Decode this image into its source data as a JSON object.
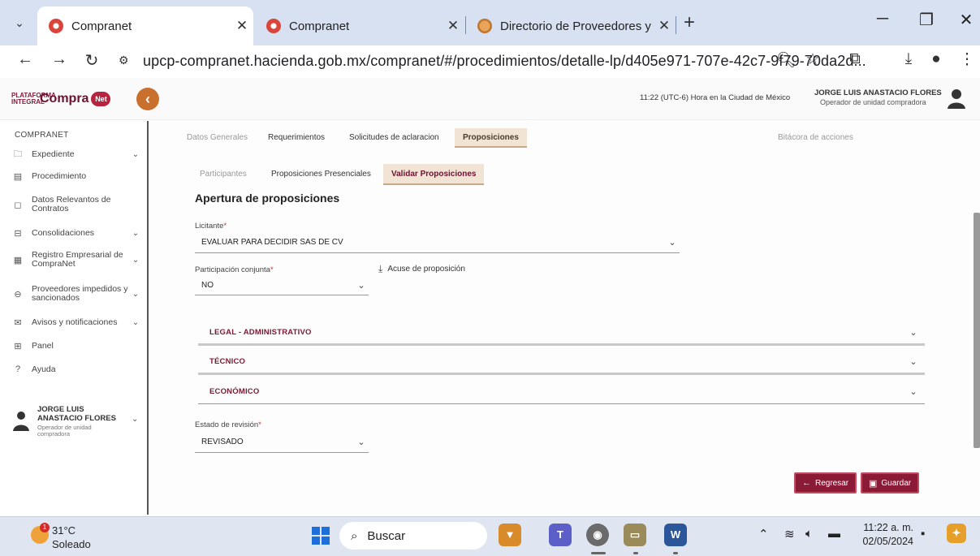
{
  "browser": {
    "tabs": [
      {
        "label": "Compranet",
        "close": "✕"
      },
      {
        "label": "Compranet",
        "close": "✕"
      },
      {
        "label": "Directorio de Proveedores y Co",
        "close": "✕"
      }
    ],
    "url": "upcp-compranet.hacienda.gob.mx/compranet/#/procedimientos/detalle-lp/d405e971-707e-42c7-9f79-70da2d..."
  },
  "header": {
    "logo_small": "PLATAFORMA INTEGRAL",
    "logo_text": "Compra",
    "logo_badge": "Net",
    "time_info": "11:22 (UTC-6) Hora en la Ciudad de México",
    "user_name": "JORGE LUIS ANASTACIO FLORES",
    "user_role": "Operador de unidad compradora"
  },
  "sidebar": {
    "title": "COMPRANET",
    "items": [
      {
        "label": "Expediente",
        "icon": "folder-icon"
      },
      {
        "label": "Procedimiento",
        "icon": "document-icon"
      },
      {
        "label": "Datos Relevantos de Contratos",
        "icon": "bookmark-icon"
      },
      {
        "label": "Consolidaciones",
        "icon": "layers-icon"
      },
      {
        "label": "Registro Empresarial de CompraNet",
        "icon": "id-card-icon"
      },
      {
        "label": "Proveedores impedidos y sancionados",
        "icon": "ban-icon"
      },
      {
        "label": "Avisos y notificaciones",
        "icon": "mail-icon"
      },
      {
        "label": "Panel",
        "icon": "grid-icon"
      },
      {
        "label": "Ayuda",
        "icon": "help-icon"
      }
    ],
    "user_name": "JORGE LUIS ANASTACIO FLORES",
    "user_role": "Operador de unidad compradora"
  },
  "main": {
    "tabs": [
      "Datos Generales",
      "Requerimientos",
      "Solicitudes de aclaracion",
      "Proposiciones",
      "Bitácora de acciones"
    ],
    "subtabs": [
      "Participantes",
      "Proposiciones Presenciales",
      "Validar Proposiciones"
    ],
    "section_title": "Apertura de proposiciones",
    "licitante_label": "Licitante",
    "licitante_value": "EVALUAR PARA DECIDIR SAS DE CV",
    "participacion_label": "Participación conjunta",
    "participacion_value": "NO",
    "acuse_label": "Acuse de proposición",
    "accordions": [
      "LEGAL - ADMINISTRATIVO",
      "TÉCNICO",
      "ECONÓMICO"
    ],
    "estado_label": "Estado de revisión",
    "estado_value": "REVISADO",
    "required_mark": "*",
    "back_button": "Regresar",
    "save_button": "Guardar"
  },
  "taskbar": {
    "temperature": "31°C",
    "weather": "Soleado",
    "weather_badge": "1",
    "search": "Buscar",
    "time": "11:22 a. m.",
    "date": "02/05/2024"
  }
}
